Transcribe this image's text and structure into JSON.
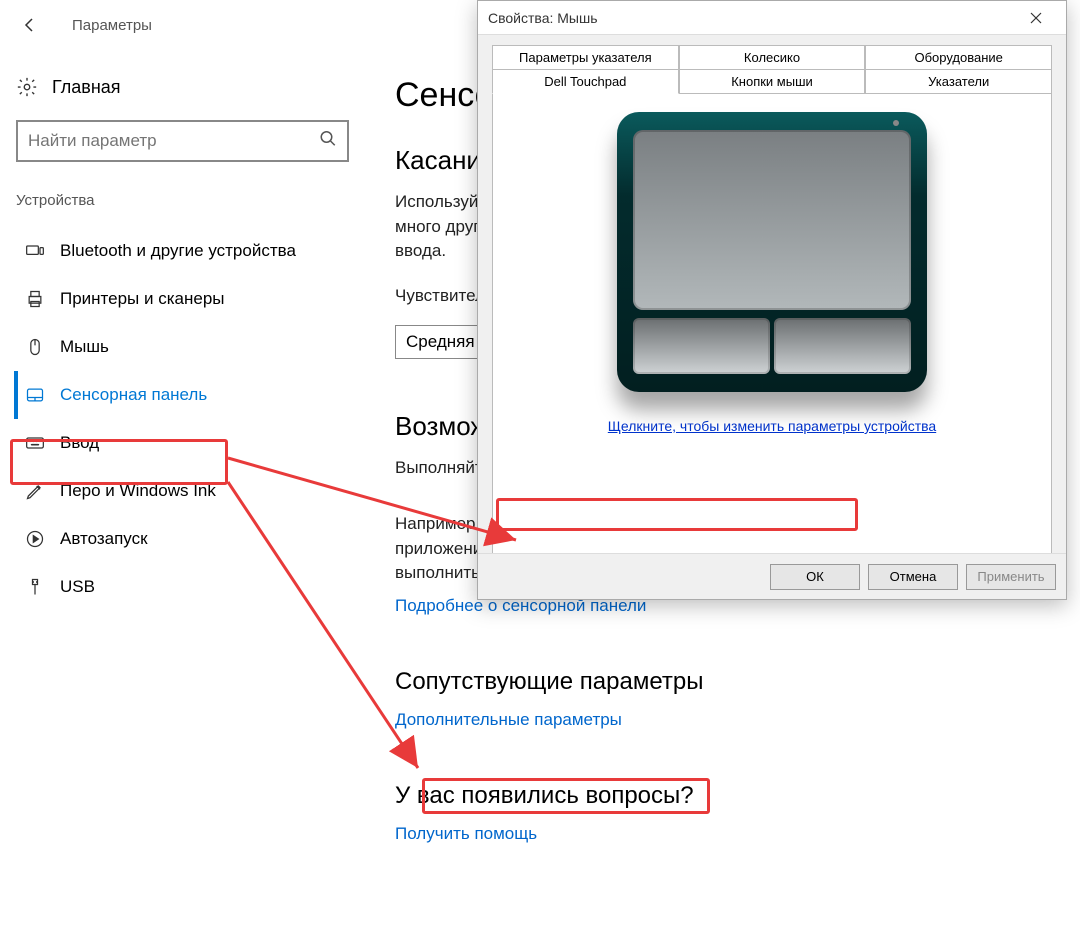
{
  "header": {
    "title": "Параметры"
  },
  "sidebar": {
    "home": "Главная",
    "search_placeholder": "Найти параметр",
    "category": "Устройства",
    "items": [
      {
        "label": "Bluetooth и другие устройства"
      },
      {
        "label": "Принтеры и сканеры"
      },
      {
        "label": "Мышь"
      },
      {
        "label": "Сенсорная панель"
      },
      {
        "label": "Ввод"
      },
      {
        "label": "Перо и Windows Ink"
      },
      {
        "label": "Автозапуск"
      },
      {
        "label": "USB"
      }
    ]
  },
  "main": {
    "h1": "Сенсорная панель",
    "touch_h2": "Касания",
    "touch_p1": "Используйте касания для щелчка левой или правой кнопкой мыши, выбора и много другого. Уменьшите чувствительность если случайно касаетесь во время ввода.",
    "touch_label": "Чувствительность сенсорной панели",
    "touch_value": "Средняя",
    "scroll_h2": "Возможности прокрутки и масштабирования",
    "scroll_p1": "Выполняйте прокрутку и масштабирование касанием двух пальцев.",
    "gest_p": "Например коснитесь сенсорной панели тремя пальцами чтобы увидеть открытые приложения, или один раз коснитесь приложения двумя пальцами, чтобы выполнить щелчок правой кнопкой мыши.",
    "more_link": "Подробнее о сенсорной панели",
    "related_h2": "Сопутствующие параметры",
    "related_link": "Дополнительные параметры",
    "help_h2": "У вас появились вопросы?",
    "help_link": "Получить помощь"
  },
  "dialog": {
    "title": "Свойства: Мышь",
    "tabs_row1": [
      "Параметры указателя",
      "Колесико",
      "Оборудование"
    ],
    "tabs_row2": [
      "Dell Touchpad",
      "Кнопки мыши",
      "Указатели"
    ],
    "link": "Щелкните, чтобы изменить параметры устройства ",
    "ok": "ОК",
    "cancel": "Отмена",
    "apply": "Применить"
  }
}
